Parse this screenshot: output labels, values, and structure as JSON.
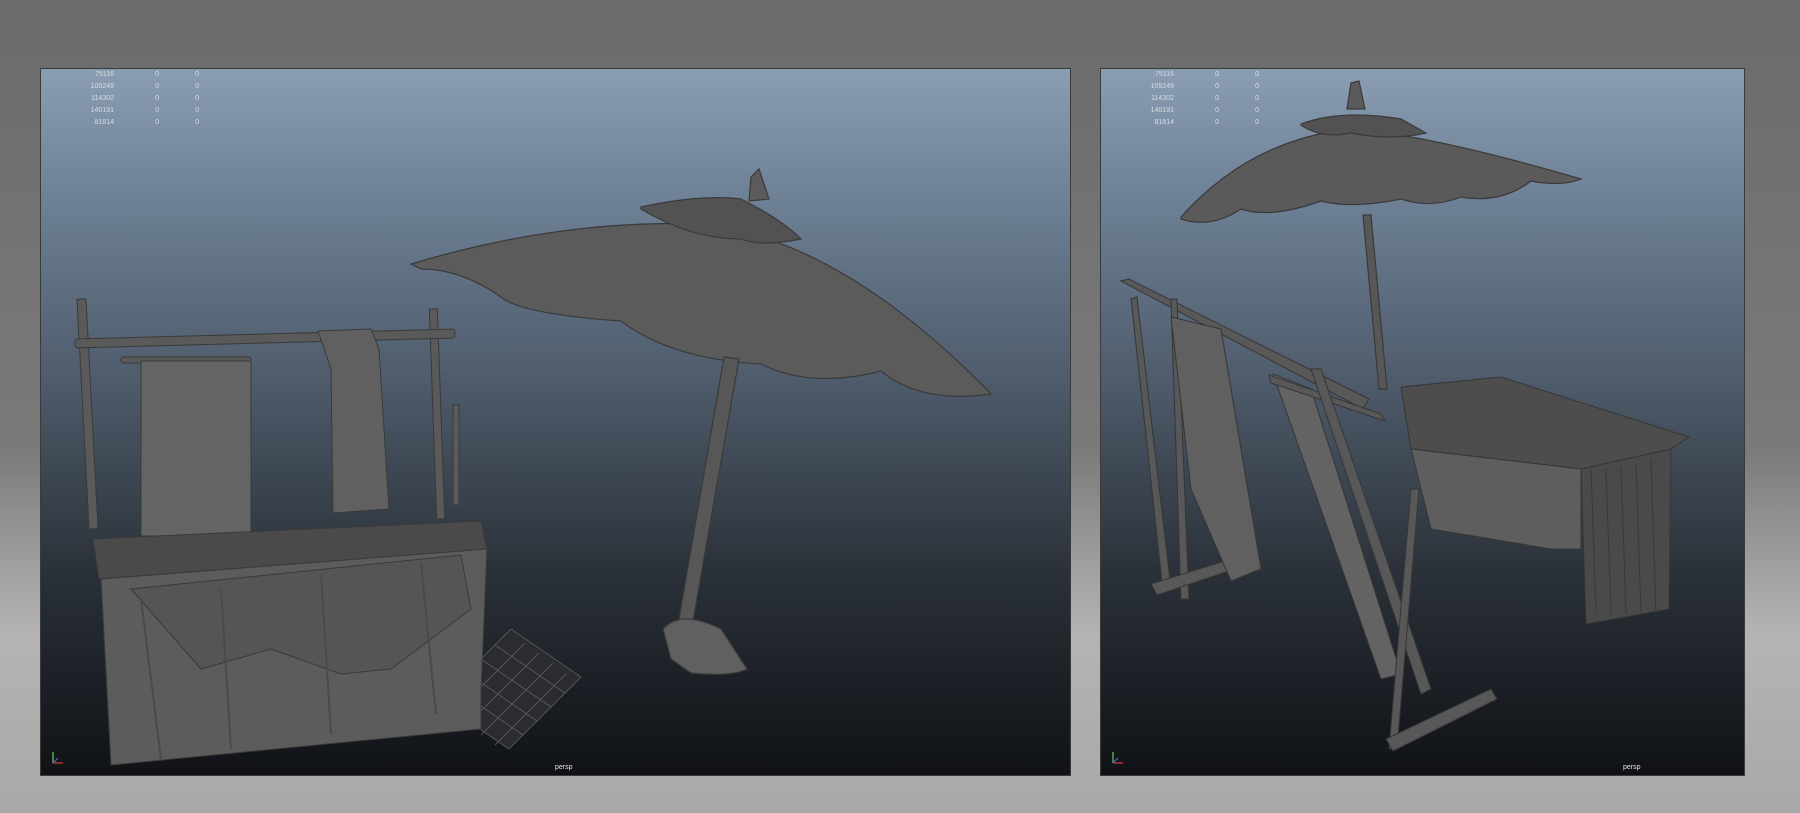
{
  "viewports": [
    {
      "camera": "persp",
      "hud": [
        {
          "v": "75116",
          "a": "0",
          "b": "0"
        },
        {
          "v": "109249",
          "a": "0",
          "b": "0"
        },
        {
          "v": "114302",
          "a": "0",
          "b": "0"
        },
        {
          "v": "140191",
          "a": "0",
          "b": "0"
        },
        {
          "v": "81814",
          "a": "0",
          "b": "0"
        }
      ]
    },
    {
      "camera": "persp",
      "hud": [
        {
          "v": "75116",
          "a": "0",
          "b": "0"
        },
        {
          "v": "109249",
          "a": "0",
          "b": "0"
        },
        {
          "v": "114302",
          "a": "0",
          "b": "0"
        },
        {
          "v": "140191",
          "a": "0",
          "b": "0"
        },
        {
          "v": "81814",
          "a": "0",
          "b": "0"
        }
      ]
    }
  ],
  "colors": {
    "model": "#5a5a5a",
    "model_dark": "#3c3c3c",
    "axis_x": "#d43a3a",
    "axis_y": "#5ad45a",
    "axis_z": "#4a6ad4"
  }
}
